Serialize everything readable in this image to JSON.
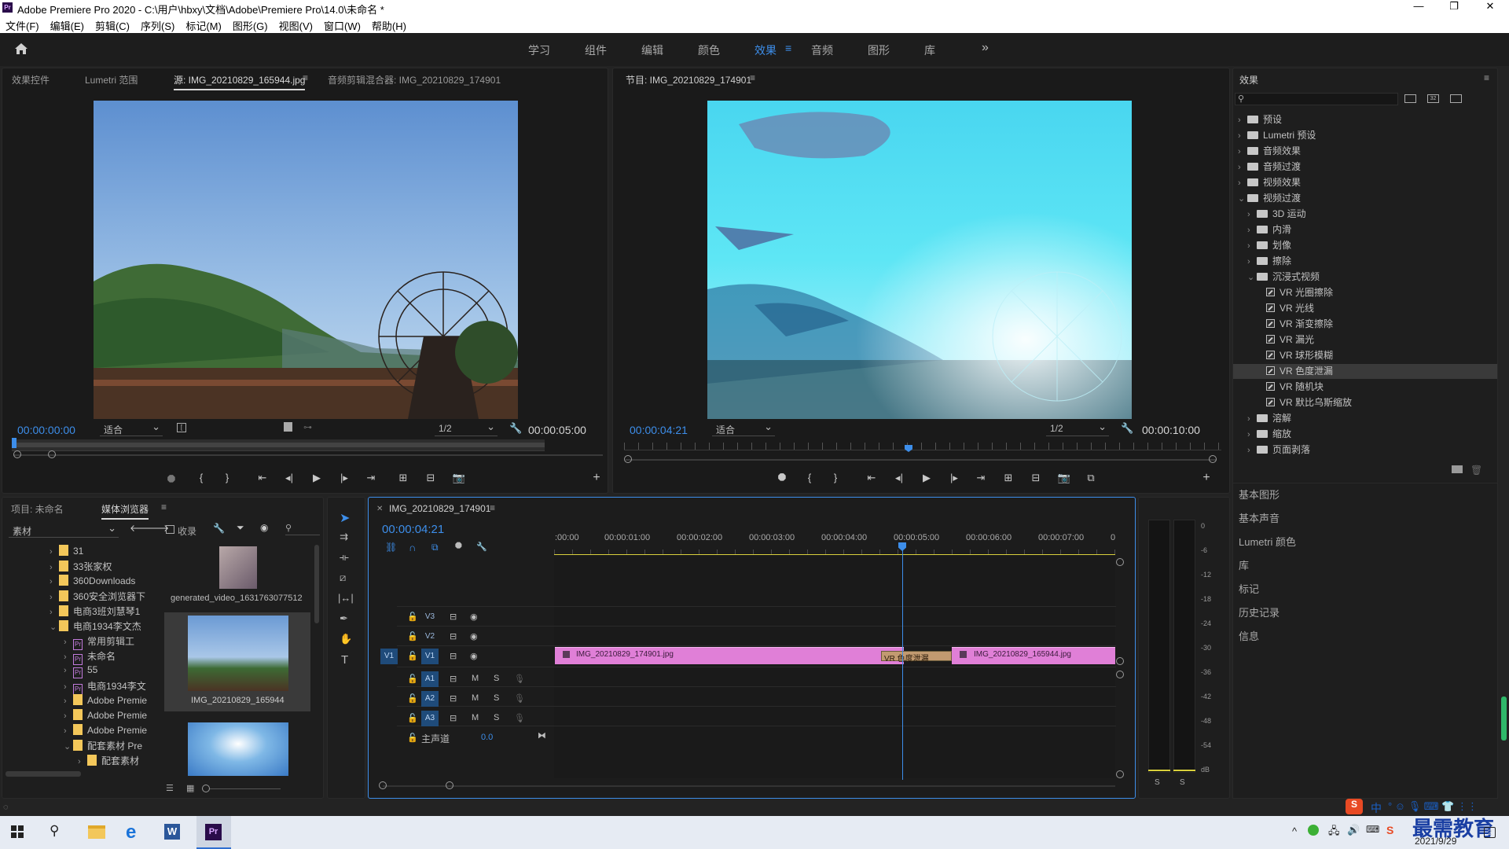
{
  "window": {
    "title": "Adobe Premiere Pro 2020 - C:\\用户\\hbxy\\文档\\Adobe\\Premiere Pro\\14.0\\未命名 *"
  },
  "menu": [
    "文件(F)",
    "编辑(E)",
    "剪辑(C)",
    "序列(S)",
    "标记(M)",
    "图形(G)",
    "视图(V)",
    "窗口(W)",
    "帮助(H)"
  ],
  "workspaces": {
    "tabs": [
      "学习",
      "组件",
      "编辑",
      "颜色",
      "效果",
      "音频",
      "图形",
      "库"
    ],
    "active": "效果"
  },
  "source_panel": {
    "tabs": [
      "效果控件",
      "Lumetri 范围",
      "源: IMG_20210829_165944.jpg",
      "音频剪辑混合器: IMG_20210829_174901"
    ],
    "timecode": "00:00:00:00",
    "fit": "适合",
    "resolution": "1/2",
    "duration": "00:00:05:00"
  },
  "program_panel": {
    "title": "节目: IMG_20210829_174901",
    "timecode": "00:00:04:21",
    "fit": "适合",
    "resolution": "1/2",
    "duration": "00:00:10:00"
  },
  "effects_panel": {
    "title": "效果",
    "tree": [
      {
        "label": "预设",
        "level": 0,
        "type": "bin",
        "expanded": false
      },
      {
        "label": "Lumetri 预设",
        "level": 0,
        "type": "bin",
        "expanded": false
      },
      {
        "label": "音频效果",
        "level": 0,
        "type": "folder",
        "expanded": false
      },
      {
        "label": "音频过渡",
        "level": 0,
        "type": "folder",
        "expanded": false
      },
      {
        "label": "视频效果",
        "level": 0,
        "type": "folder",
        "expanded": false
      },
      {
        "label": "视频过渡",
        "level": 0,
        "type": "folder",
        "expanded": true
      },
      {
        "label": "3D 运动",
        "level": 1,
        "type": "folder",
        "expanded": false
      },
      {
        "label": "内滑",
        "level": 1,
        "type": "folder",
        "expanded": false
      },
      {
        "label": "划像",
        "level": 1,
        "type": "folder",
        "expanded": false
      },
      {
        "label": "擦除",
        "level": 1,
        "type": "folder",
        "expanded": false
      },
      {
        "label": "沉浸式视频",
        "level": 1,
        "type": "folder",
        "expanded": true
      },
      {
        "label": "VR 光圈擦除",
        "level": 2,
        "type": "fx"
      },
      {
        "label": "VR 光线",
        "level": 2,
        "type": "fx"
      },
      {
        "label": "VR 渐变擦除",
        "level": 2,
        "type": "fx"
      },
      {
        "label": "VR 漏光",
        "level": 2,
        "type": "fx"
      },
      {
        "label": "VR 球形模糊",
        "level": 2,
        "type": "fx"
      },
      {
        "label": "VR 色度泄漏",
        "level": 2,
        "type": "fx",
        "selected": true
      },
      {
        "label": "VR 随机块",
        "level": 2,
        "type": "fx"
      },
      {
        "label": "VR 默比乌斯缩放",
        "level": 2,
        "type": "fx"
      },
      {
        "label": "溶解",
        "level": 1,
        "type": "folder",
        "expanded": false
      },
      {
        "label": "缩放",
        "level": 1,
        "type": "folder",
        "expanded": false
      },
      {
        "label": "页面剥落",
        "level": 1,
        "type": "folder",
        "expanded": false
      }
    ],
    "side_panels": [
      "基本图形",
      "基本声音",
      "Lumetri 颜色",
      "库",
      "标记",
      "历史记录",
      "信息"
    ]
  },
  "project_panel": {
    "tabs": [
      "项目: 未命名",
      "媒体浏览器"
    ],
    "location": "素材",
    "collect_label": "收录",
    "tree": [
      {
        "label": "31",
        "kind": "folder",
        "level": 0
      },
      {
        "label": "33张家权",
        "kind": "folder",
        "level": 0
      },
      {
        "label": "360Downloads",
        "kind": "folder",
        "level": 0
      },
      {
        "label": "360安全浏览器下",
        "kind": "folder",
        "level": 0
      },
      {
        "label": "电商3班刘慧琴1",
        "kind": "folder",
        "level": 0
      },
      {
        "label": "电商1934李文杰",
        "kind": "folder",
        "level": 0,
        "expanded": true
      },
      {
        "label": "常用剪辑工",
        "kind": "pr",
        "level": 1
      },
      {
        "label": "未命名",
        "kind": "pr",
        "level": 1
      },
      {
        "label": "55",
        "kind": "pr",
        "level": 1
      },
      {
        "label": "电商1934李文",
        "kind": "pr",
        "level": 1
      },
      {
        "label": "Adobe Premie",
        "kind": "folder",
        "level": 1
      },
      {
        "label": "Adobe Premie",
        "kind": "folder",
        "level": 1
      },
      {
        "label": "Adobe Premie",
        "kind": "folder",
        "level": 1
      },
      {
        "label": "配套素材 Pre",
        "kind": "folder",
        "level": 1,
        "expanded": true
      },
      {
        "label": "配套素材",
        "kind": "folder",
        "level": 2
      }
    ],
    "thumbnails": [
      {
        "label": "generated_video_1631763077512"
      },
      {
        "label": "IMG_20210829_165944"
      }
    ]
  },
  "timeline": {
    "sequence": "IMG_20210829_174901",
    "timecode": "00:00:04:21",
    "ruler": [
      ":00:00",
      "00:00:01:00",
      "00:00:02:00",
      "00:00:03:00",
      "00:00:04:00",
      "00:00:05:00",
      "00:00:06:00",
      "00:00:07:00",
      "0"
    ],
    "video_tracks": [
      "V3",
      "V2",
      "V1"
    ],
    "audio_tracks": [
      "A1",
      "A2",
      "A3"
    ],
    "master_label": "主声道",
    "master_value": "0.0",
    "clips": [
      {
        "name": "IMG_20210829_174901.jpg"
      },
      {
        "name": "VR 色度泄漏"
      },
      {
        "name": "IMG_20210829_165944.jpg"
      }
    ]
  },
  "audio_meter": {
    "scale": [
      "0",
      "-6",
      "-12",
      "-18",
      "-24",
      "-30",
      "-36",
      "-42",
      "-48",
      "-54",
      "dB"
    ],
    "solo": [
      "S",
      "S"
    ]
  },
  "taskbar": {
    "date": "2021/9/29",
    "ime": "中",
    "watermark": "最需教育"
  }
}
